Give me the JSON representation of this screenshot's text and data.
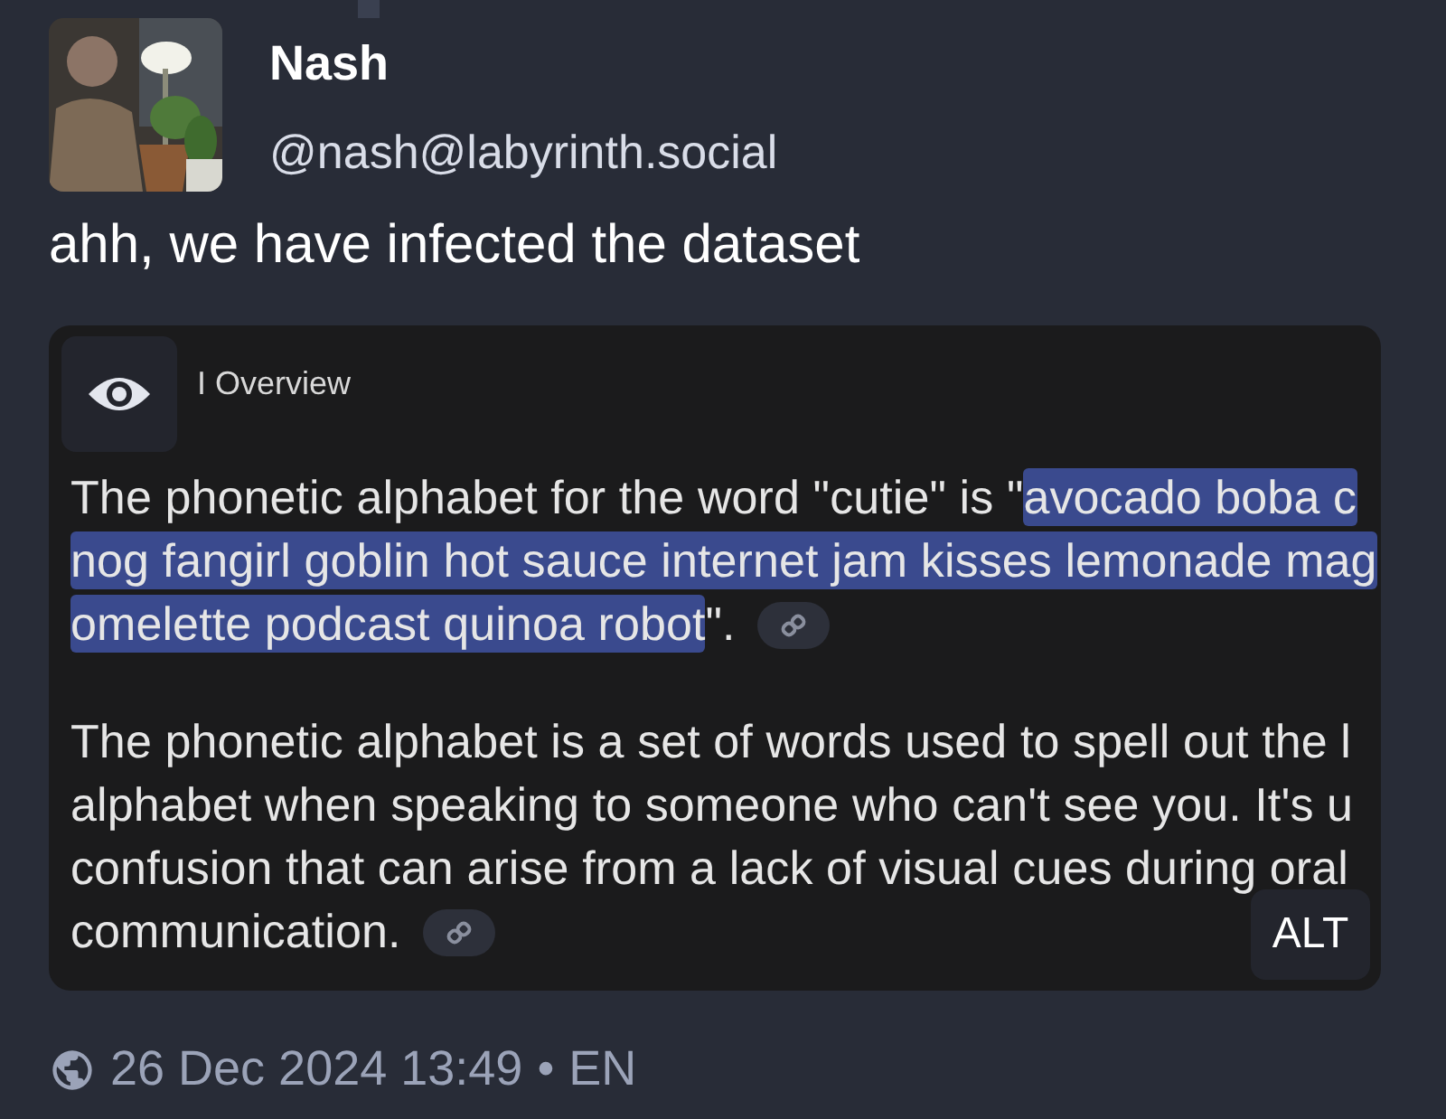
{
  "author": {
    "name": "Nash",
    "handle": "@nash@labyrinth.social"
  },
  "text": "ahh, we have infected the dataset",
  "media": {
    "header": "I Overview",
    "alt_button": "ALT",
    "paragraphs": [
      {
        "lines": [
          {
            "segments": [
              {
                "kind": "text",
                "text": "The phonetic alphabet for the word \"cutie\" is \"",
                "highlighted": false
              },
              {
                "kind": "text",
                "text": "avocado boba c",
                "highlighted": true
              }
            ]
          },
          {
            "segments": [
              {
                "kind": "text",
                "text": "nog fangirl goblin hot sauce internet jam kisses lemonade mag",
                "highlighted": true
              }
            ]
          },
          {
            "segments": [
              {
                "kind": "text",
                "text": "omelette podcast quinoa robot",
                "highlighted": true
              },
              {
                "kind": "text",
                "text": "\".",
                "highlighted": false
              },
              {
                "kind": "link"
              }
            ]
          }
        ]
      },
      {
        "lines": [
          {
            "segments": [
              {
                "kind": "text",
                "text": "The phonetic alphabet is a set of words used to spell out the l",
                "highlighted": false
              }
            ]
          },
          {
            "segments": [
              {
                "kind": "text",
                "text": "alphabet when speaking to someone who can't see you. It's u",
                "highlighted": false
              }
            ]
          },
          {
            "segments": [
              {
                "kind": "text",
                "text": "confusion that can arise from a lack of visual cues during oral",
                "highlighted": false
              }
            ]
          },
          {
            "segments": [
              {
                "kind": "text",
                "text": "communication.",
                "highlighted": false
              },
              {
                "kind": "link"
              }
            ]
          }
        ]
      }
    ]
  },
  "footer": {
    "date": "26 Dec 2024 13:49",
    "separator": "•",
    "language": "EN"
  }
}
